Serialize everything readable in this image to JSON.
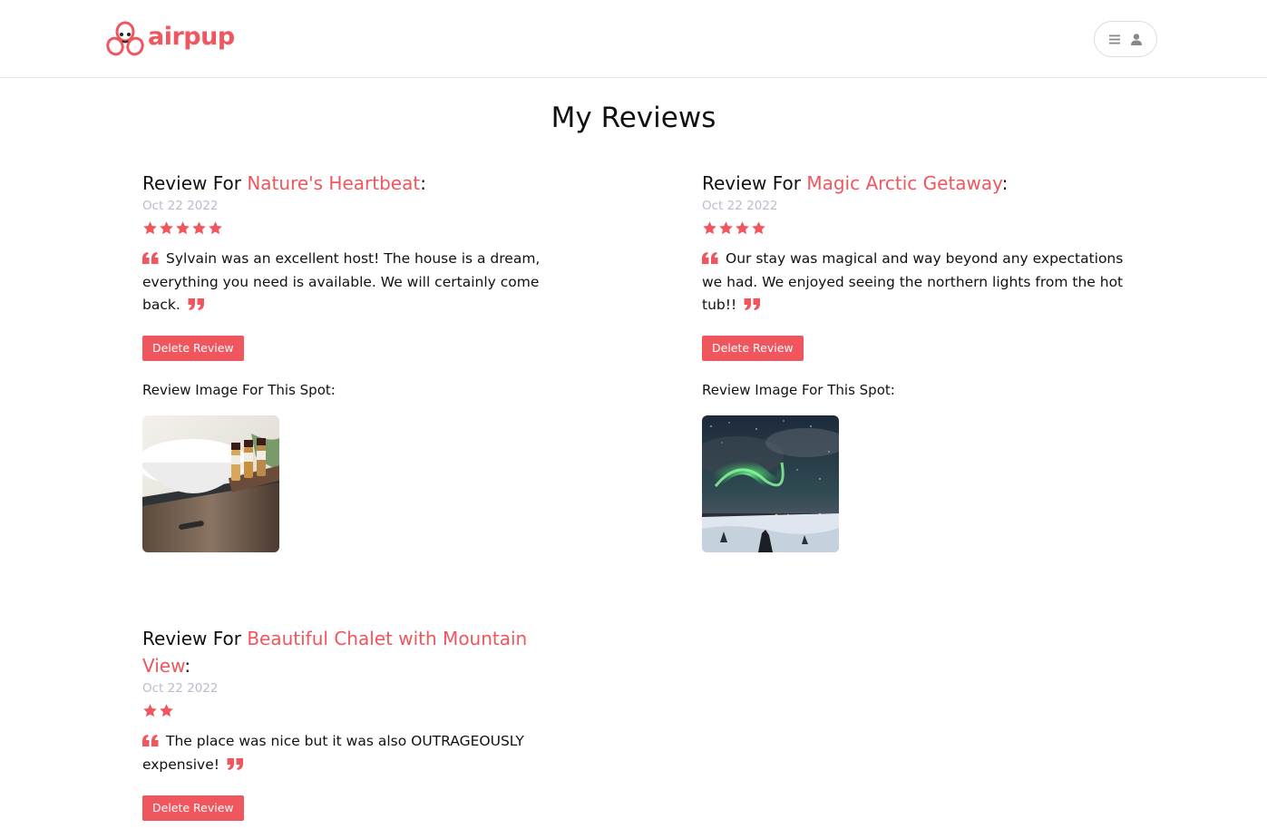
{
  "brand": {
    "name": "airpup",
    "accent": "#f0565e"
  },
  "header": {
    "menu_icon": "hamburger-icon",
    "user_icon": "user-icon"
  },
  "page": {
    "title": "My Reviews"
  },
  "reviews": [
    {
      "prefix": "Review For ",
      "spot": "Nature's Heartbeat",
      "suffix": ":",
      "date": "Oct 22 2022",
      "stars": 5,
      "text": "Sylvain was an excellent host! The house is a dream, everything you need is available. We will certainly come back.",
      "delete_label": "Delete Review",
      "image_label": "Review Image For This Spot:",
      "image_alt": "bathroom-sink-toiletries"
    },
    {
      "prefix": "Review For ",
      "spot": "Magic Arctic Getaway",
      "suffix": ":",
      "date": "Oct 22 2022",
      "stars": 4,
      "text": "Our stay was magical and way beyond any expectations we had. We enjoyed seeing the northern lights from the hot tub!!",
      "delete_label": "Delete Review",
      "image_label": "Review Image For This Spot:",
      "image_alt": "northern-lights-snow"
    },
    {
      "prefix": "Review For ",
      "spot": "Beautiful Chalet with Mountain View",
      "suffix": ":",
      "date": "Oct 22 2022",
      "stars": 2,
      "text": "The place was nice but it was also OUTRAGEOUSLY expensive!",
      "delete_label": "Delete Review"
    }
  ]
}
